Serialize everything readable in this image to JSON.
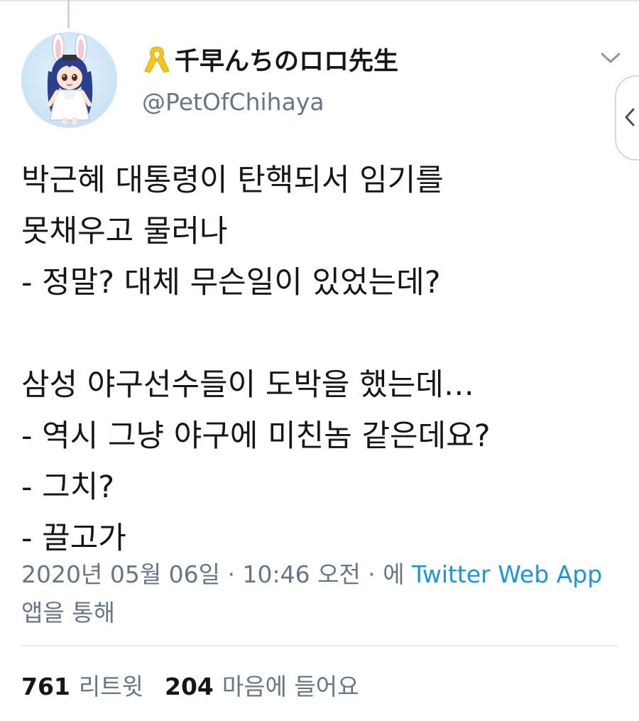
{
  "author": {
    "display_name": "千早んちのロロ先生",
    "handle": "@PetOfChihaya",
    "ribbon_icon": "yellow-ribbon-icon",
    "avatar": "anime-bunny-girl-avatar"
  },
  "tweet": {
    "lines": [
      "박근혜 대통령이 탄핵되서 임기를",
      "못채우고 물러나",
      "- 정말? 대체 무슨일이 있었는데?",
      "",
      "삼성 야구선수들이 도박을 했는데…",
      "- 역시 그냥 야구에 미친놈 같은데요?",
      "- 그치?",
      "- 끌고가"
    ]
  },
  "meta": {
    "timestamp": "2020년 05월 06일 · 10:46 오전 · 에",
    "source": "Twitter Web App",
    "suffix": "앱을 통해"
  },
  "stats": {
    "retweets_count": "761",
    "retweets_label": "리트윗",
    "likes_count": "204",
    "likes_label": "마음에 들어요"
  },
  "colors": {
    "text": "#14171a",
    "secondary": "#657786",
    "link": "#1b95e0",
    "ribbon": "#f5c518"
  }
}
